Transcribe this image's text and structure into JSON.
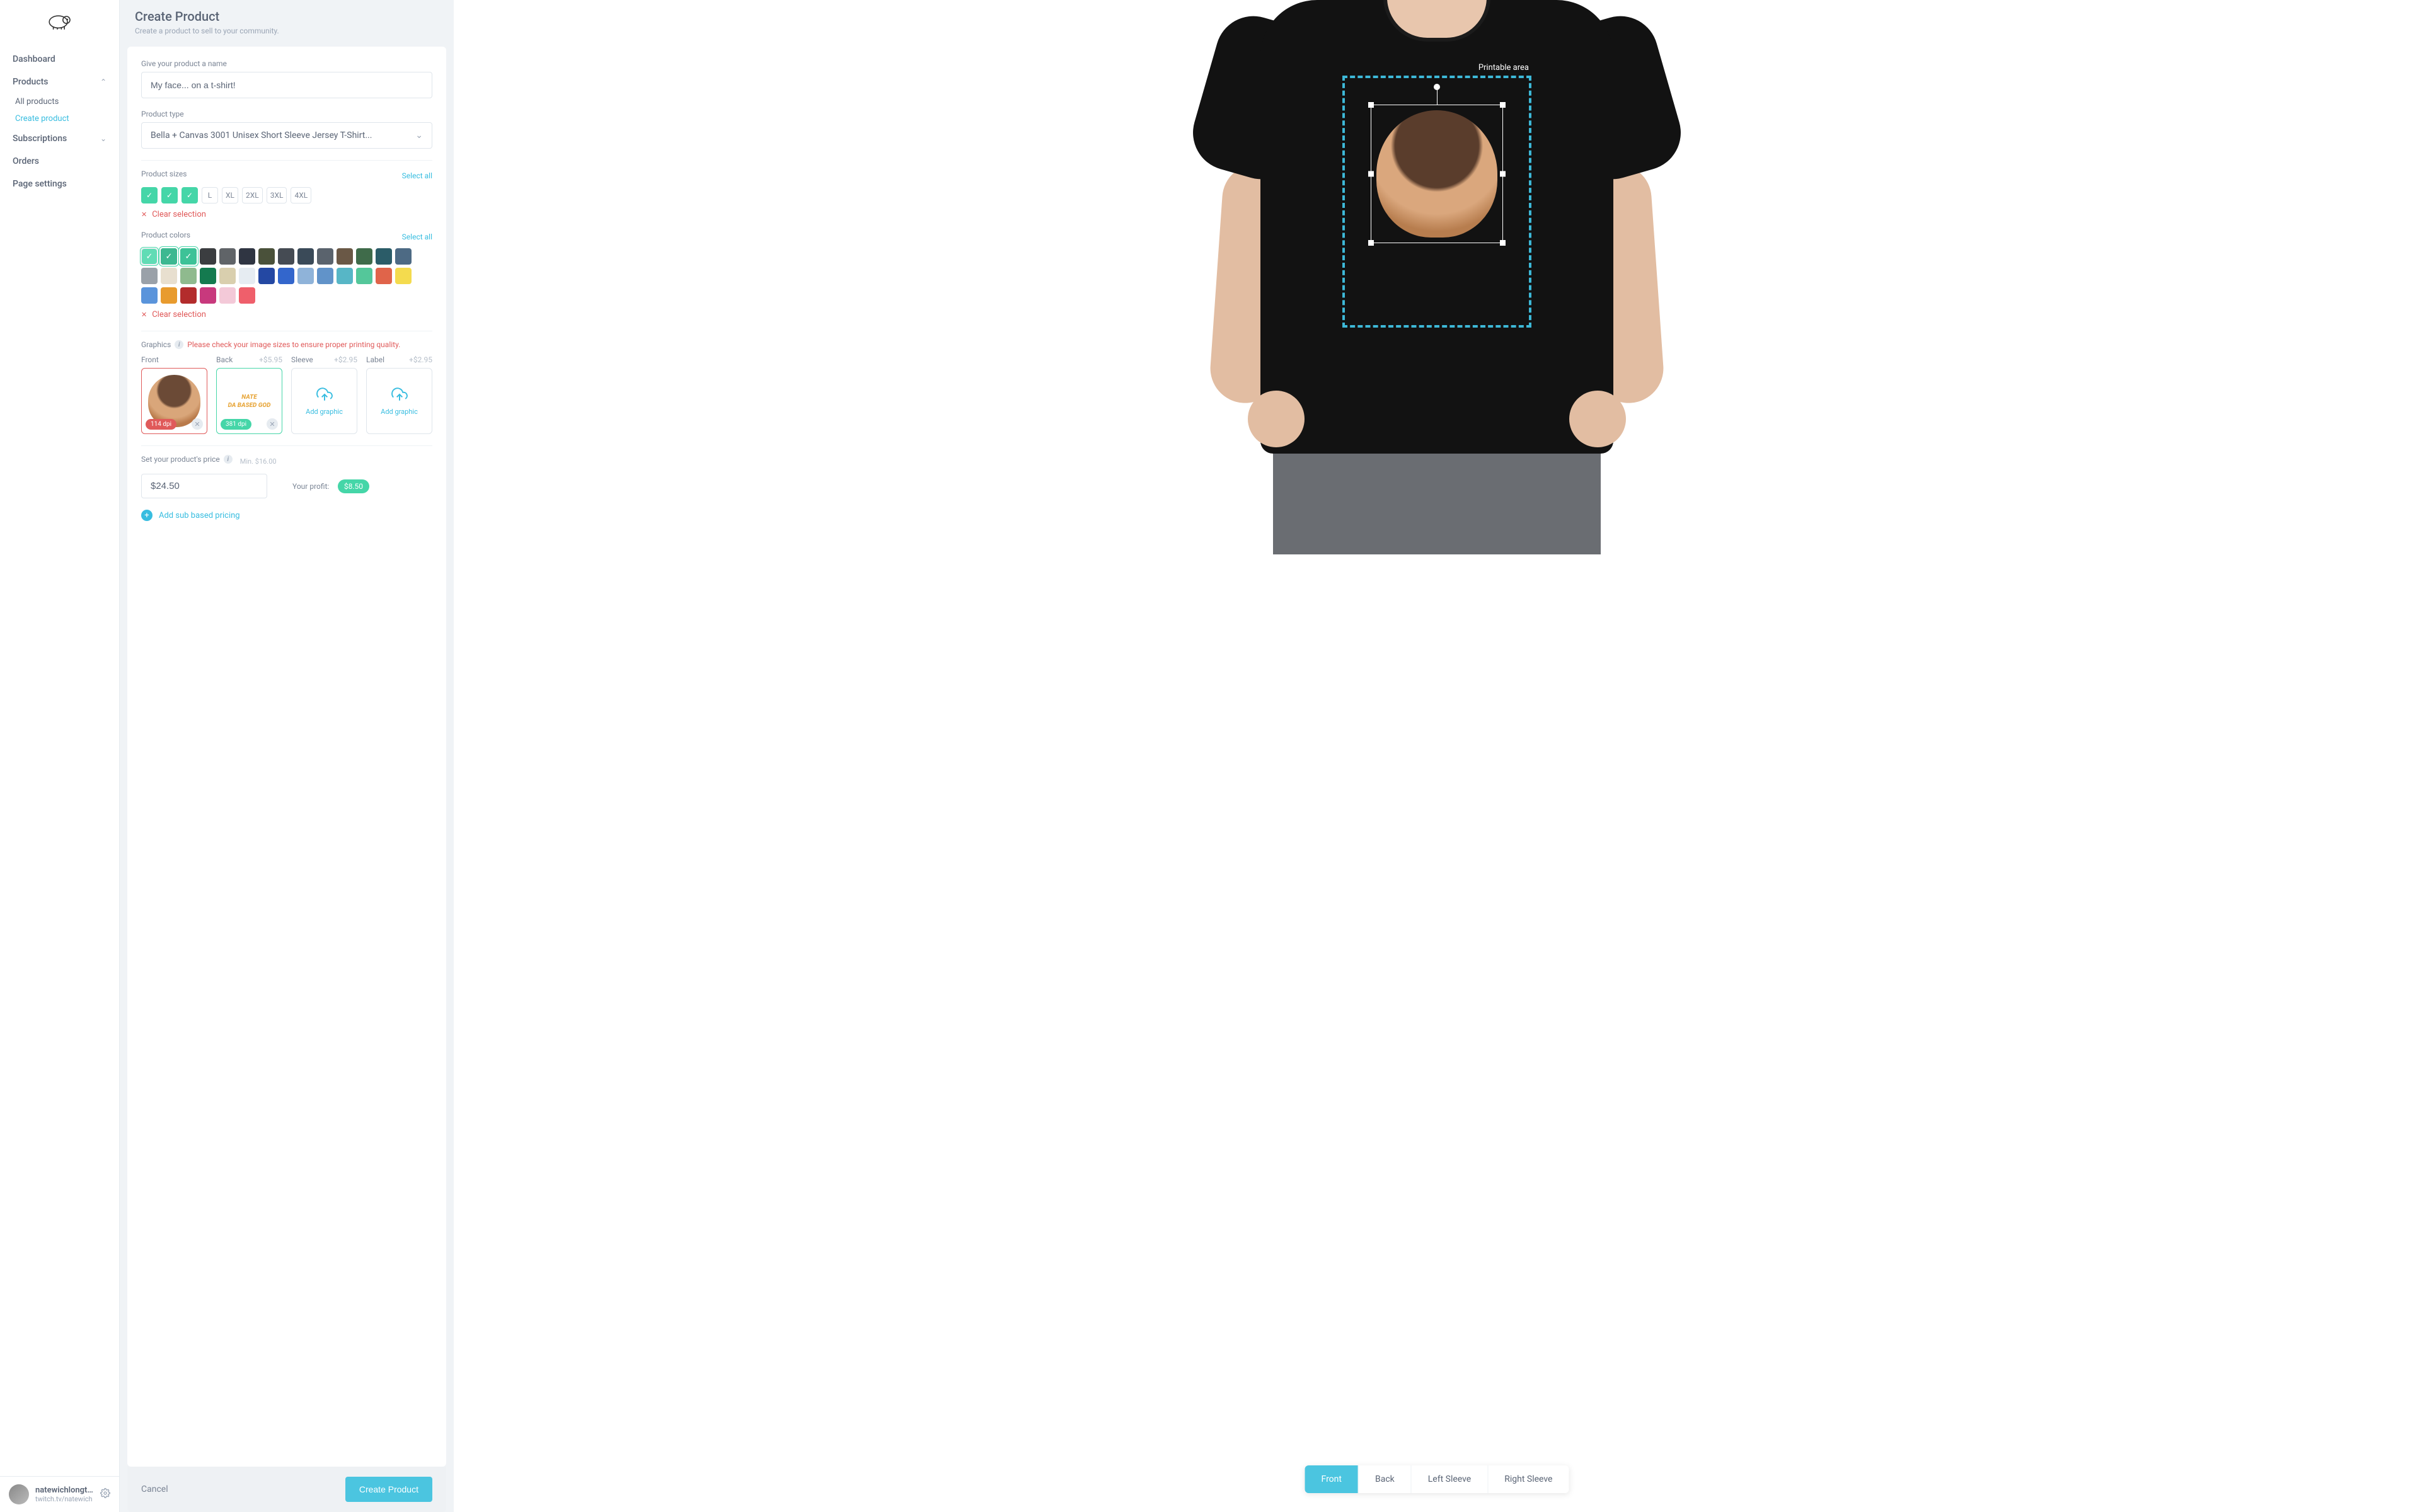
{
  "brand": {
    "logo_name": "sheep-logo"
  },
  "nav": {
    "dashboard": "Dashboard",
    "products": "Products",
    "products_sub_all": "All products",
    "products_sub_create": "Create product",
    "subscriptions": "Subscriptions",
    "orders": "Orders",
    "page_settings": "Page settings"
  },
  "user": {
    "name": "natewichlongt...",
    "subtitle": "twitch.tv/natewich"
  },
  "header": {
    "title": "Create Product",
    "subtitle": "Create a product to sell to your community."
  },
  "form": {
    "name_label": "Give your product a name",
    "name_value": "My face... on a t-shirt!",
    "type_label": "Product type",
    "type_value": "Bella + Canvas 3001 Unisex Short Sleeve Jersey T-Shirt...",
    "sizes_label": "Product sizes",
    "select_all": "Select all",
    "clear_selection": "Clear selection",
    "sizes": [
      {
        "label": "",
        "selected": true
      },
      {
        "label": "",
        "selected": true
      },
      {
        "label": "",
        "selected": true
      },
      {
        "label": "L",
        "selected": false
      },
      {
        "label": "XL",
        "selected": false
      },
      {
        "label": "2XL",
        "selected": false
      },
      {
        "label": "3XL",
        "selected": false
      },
      {
        "label": "4XL",
        "selected": false
      }
    ],
    "colors_label": "Product colors",
    "colors": [
      {
        "hex": "#ffffff",
        "selected": true
      },
      {
        "hex": "#111111",
        "selected": true
      },
      {
        "hex": "#0f5238",
        "selected": true
      },
      {
        "hex": "#3b3d40",
        "selected": false
      },
      {
        "hex": "#606468",
        "selected": false
      },
      {
        "hex": "#2f3542",
        "selected": false
      },
      {
        "hex": "#4a513a",
        "selected": false
      },
      {
        "hex": "#454b53",
        "selected": false
      },
      {
        "hex": "#3a4a58",
        "selected": false
      },
      {
        "hex": "#5a636d",
        "selected": false
      },
      {
        "hex": "#6a5846",
        "selected": false
      },
      {
        "hex": "#3f6b4a",
        "selected": false
      },
      {
        "hex": "#2b5c68",
        "selected": false
      },
      {
        "hex": "#4d6a84",
        "selected": false
      },
      {
        "hex": "#9aa1a9",
        "selected": false
      },
      {
        "hex": "#e8dfcf",
        "selected": false
      },
      {
        "hex": "#8fba8e",
        "selected": false
      },
      {
        "hex": "#147a4f",
        "selected": false
      },
      {
        "hex": "#d9cfae",
        "selected": false
      },
      {
        "hex": "#e6ecf2",
        "selected": false
      },
      {
        "hex": "#2448a3",
        "selected": false
      },
      {
        "hex": "#3366cc",
        "selected": false
      },
      {
        "hex": "#8fb3d9",
        "selected": false
      },
      {
        "hex": "#6193c9",
        "selected": false
      },
      {
        "hex": "#57b6c6",
        "selected": false
      },
      {
        "hex": "#54c79a",
        "selected": false
      },
      {
        "hex": "#e0644a",
        "selected": false
      },
      {
        "hex": "#f4db4e",
        "selected": false
      },
      {
        "hex": "#5a94db",
        "selected": false
      },
      {
        "hex": "#e89b2e",
        "selected": false
      },
      {
        "hex": "#b32c2c",
        "selected": false
      },
      {
        "hex": "#c8397d",
        "selected": false
      },
      {
        "hex": "#f3c9d8",
        "selected": false
      },
      {
        "hex": "#ef5f6b",
        "selected": false
      }
    ],
    "graphics_label": "Graphics",
    "graphics_warning": "Please check your image sizes to ensure proper printing quality.",
    "graphics": {
      "front": {
        "label": "Front",
        "dpi": "114 dpi"
      },
      "back": {
        "label": "Back",
        "price": "+$5.95",
        "dpi": "381 dpi",
        "line1": "NATE",
        "line2": "DA BASED GOD"
      },
      "sleeve": {
        "label": "Sleeve",
        "price": "+$2.95",
        "cta": "Add graphic"
      },
      "label": {
        "label": "Label",
        "price": "+$2.95",
        "cta": "Add graphic"
      }
    },
    "price_label": "Set your product's price",
    "min_price": "Min. $16.00",
    "price_value": "$24.50",
    "profit_label": "Your profit:",
    "profit_value": "$8.50",
    "add_sub": "Add sub based pricing"
  },
  "footer": {
    "cancel": "Cancel",
    "create": "Create Product"
  },
  "preview": {
    "printable_label": "Printable area",
    "tabs": {
      "front": "Front",
      "back": "Back",
      "left": "Left Sleeve",
      "right": "Right Sleeve"
    }
  }
}
